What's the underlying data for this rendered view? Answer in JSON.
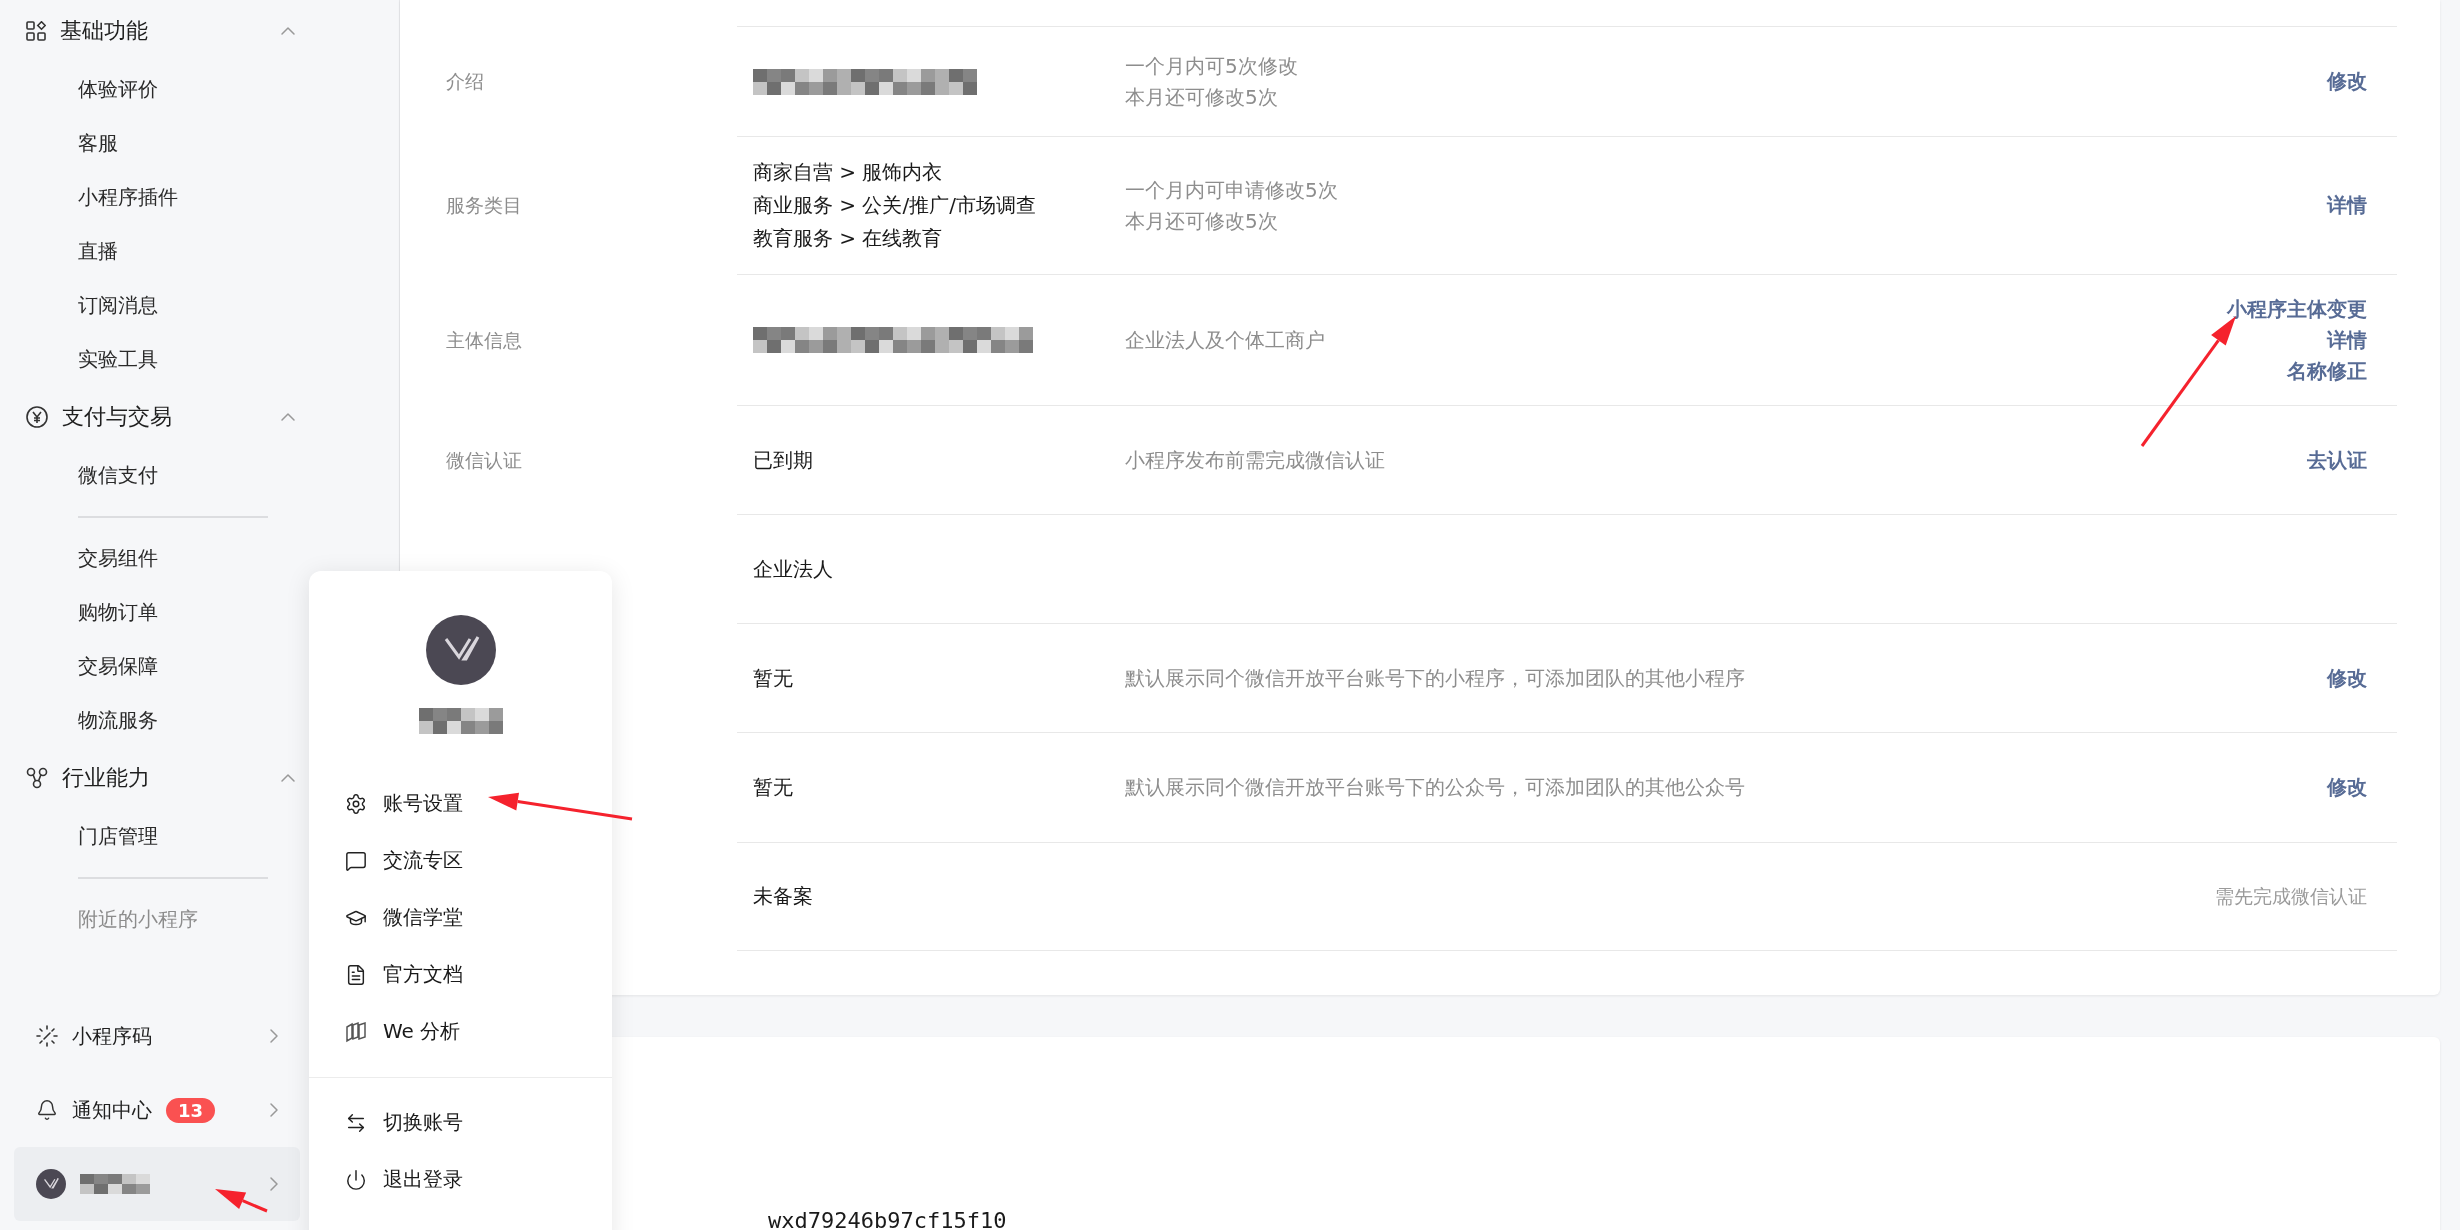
{
  "sidebar": {
    "groups": [
      {
        "title": "基础功能",
        "expanded": true,
        "sections": [
          [
            {
              "label": "体验评价",
              "disabled": false
            },
            {
              "label": "客服",
              "disabled": false
            },
            {
              "label": "小程序插件",
              "disabled": false
            },
            {
              "label": "直播",
              "disabled": false
            },
            {
              "label": "订阅消息",
              "disabled": false
            },
            {
              "label": "实验工具",
              "disabled": false
            }
          ]
        ]
      },
      {
        "title": "支付与交易",
        "expanded": true,
        "sections": [
          [
            {
              "label": "微信支付",
              "disabled": false
            }
          ],
          [
            {
              "label": "交易组件",
              "disabled": false
            },
            {
              "label": "购物订单",
              "disabled": false
            },
            {
              "label": "交易保障",
              "disabled": false
            },
            {
              "label": "物流服务",
              "disabled": false
            }
          ]
        ]
      },
      {
        "title": "行业能力",
        "expanded": true,
        "sections": [
          [
            {
              "label": "门店管理",
              "disabled": false
            }
          ],
          [
            {
              "label": "附近的小程序",
              "disabled": true
            }
          ]
        ]
      }
    ],
    "bottom": [
      {
        "label": "小程序码"
      },
      {
        "label": "通知中心",
        "badge": "13"
      }
    ]
  },
  "table": {
    "rows": [
      {
        "label": "介绍",
        "notes": [
          "一个月内可5次修改",
          "本月还可修改5次"
        ],
        "actions": [
          {
            "kind": "link",
            "label": "修改"
          }
        ]
      },
      {
        "label": "服务类目",
        "value_lines": [
          "商家自营 > 服饰内衣",
          "商业服务 > 公关/推广/市场调查",
          "教育服务 > 在线教育"
        ],
        "notes": [
          "一个月内可申请修改5次",
          "本月还可修改5次"
        ],
        "actions": [
          {
            "kind": "link",
            "label": "详情"
          }
        ]
      },
      {
        "label": "主体信息",
        "notes": [
          "企业法人及个体工商户"
        ],
        "actions": [
          {
            "kind": "link",
            "label": "小程序主体变更"
          },
          {
            "kind": "link",
            "label": "详情"
          },
          {
            "kind": "link",
            "label": "名称修正"
          }
        ]
      },
      {
        "label": "微信认证",
        "value_lines": [
          "已到期"
        ],
        "notes": [
          "小程序发布前需完成微信认证"
        ],
        "actions": [
          {
            "kind": "link",
            "label": "去认证"
          }
        ]
      },
      {
        "value_lines": [
          "企业法人"
        ],
        "notes": [],
        "actions": []
      },
      {
        "value_lines": [
          "暂无"
        ],
        "notes": [
          "默认展示同个微信开放平台账号下的小程序，可添加团队的其他小程序"
        ],
        "actions": [
          {
            "kind": "link",
            "label": "修改"
          }
        ]
      },
      {
        "value_lines": [
          "暂无"
        ],
        "notes": [
          "默认展示同个微信开放平台账号下的公众号，可添加团队的其他公众号"
        ],
        "actions": [
          {
            "kind": "link",
            "label": "修改"
          }
        ]
      },
      {
        "value_lines": [
          "未备案"
        ],
        "notes": [],
        "actions": [
          {
            "kind": "hint",
            "label": "需先完成微信认证"
          }
        ]
      }
    ]
  },
  "second_card": {
    "value": "wxd79246b97cf15f10"
  },
  "account_menu": {
    "groups": [
      [
        {
          "label": "账号设置"
        },
        {
          "label": "交流专区"
        },
        {
          "label": "微信学堂"
        },
        {
          "label": "官方文档"
        },
        {
          "label": "We 分析"
        }
      ],
      [
        {
          "label": "切换账号"
        },
        {
          "label": "退出登录"
        }
      ]
    ]
  },
  "annotations": [
    {
      "kind": "arrow"
    },
    {
      "kind": "arrow"
    },
    {
      "kind": "arrow"
    }
  ]
}
